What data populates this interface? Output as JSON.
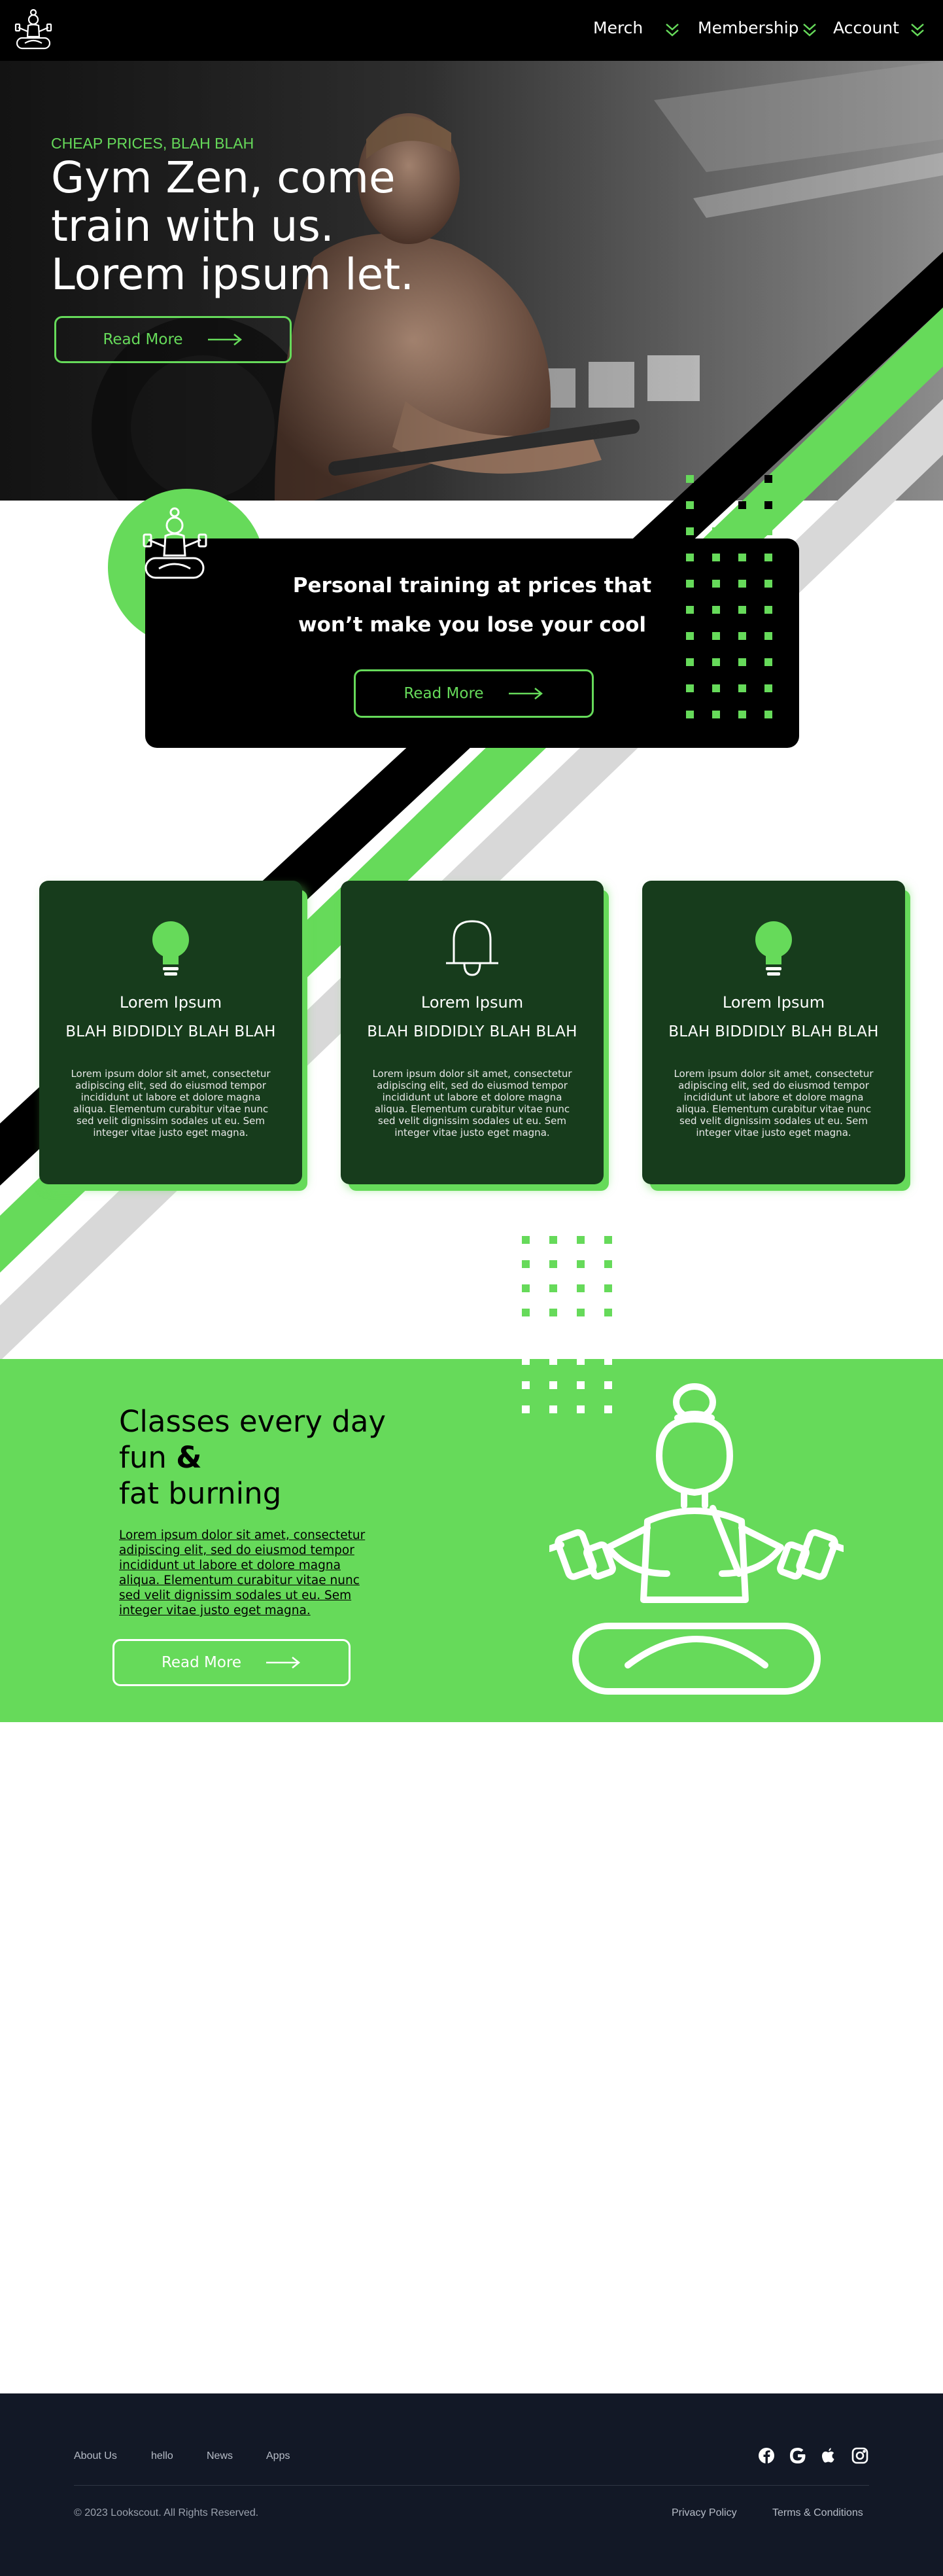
{
  "nav": {
    "logo_icon": "meditating-dumbbell-logo-icon",
    "items": [
      {
        "label": "Merch",
        "icon": "double-chevron-down-icon"
      },
      {
        "label": "Membership",
        "icon": "double-chevron-down-icon"
      },
      {
        "label": "Account",
        "icon": "double-chevron-down-icon"
      }
    ]
  },
  "hero": {
    "eyebrow": "CHEAP PRICES, BLAH BLAH",
    "title": "Gym Zen, come train with us. Lorem ipsum let.",
    "button_label": "Read More",
    "button_icon": "arrow-right-icon"
  },
  "cta": {
    "title": "Personal training at prices that won’t make you lose your cool",
    "button_label": "Read More",
    "button_icon": "arrow-right-icon"
  },
  "features": [
    {
      "icon": "lightbulb-icon",
      "title": "Lorem Ipsum",
      "subtitle": "BLAH BIDDIDLY BLAH BLAH",
      "body": "Lorem ipsum dolor sit amet, consectetur adipiscing elit, sed do eiusmod tempor incididunt ut labore et dolore magna aliqua. Elementum curabitur vitae nunc sed velit dignissim sodales ut eu. Sem integer vitae justo eget magna."
    },
    {
      "icon": "bell-icon",
      "title": "Lorem Ipsum",
      "subtitle": "BLAH BIDDIDLY BLAH BLAH",
      "body": "Lorem ipsum dolor sit amet, consectetur adipiscing elit, sed do eiusmod tempor incididunt ut labore et dolore magna aliqua. Elementum curabitur vitae nunc sed velit dignissim sodales ut eu. Sem integer vitae justo eget magna."
    },
    {
      "icon": "lightbulb-icon",
      "title": "Lorem Ipsum",
      "subtitle": "BLAH BIDDIDLY BLAH BLAH",
      "body": "Lorem ipsum dolor sit amet, consectetur adipiscing elit, sed do eiusmod tempor incididunt ut labore et dolore magna aliqua. Elementum curabitur vitae nunc sed velit dignissim sodales ut eu. Sem integer vitae justo eget magna."
    }
  ],
  "classes": {
    "title_line1": "Classes every day",
    "title_line2_a": "fun ",
    "title_line2_b": "&",
    "title_line3": "fat burning",
    "body": "Lorem ipsum dolor sit amet, consectetur adipiscing elit, sed do eiusmod tempor incididunt ut labore et dolore magna aliqua. Elementum curabitur vitae nunc sed velit dignissim sodales ut eu. Sem integer vitae justo eget magna.",
    "button_label": "Read More",
    "figure_icon": "meditating-dumbbell-figure-icon"
  },
  "footer": {
    "links": [
      "About Us",
      "hello",
      "News",
      "Apps"
    ],
    "social": [
      "facebook-icon",
      "google-icon",
      "apple-icon",
      "instagram-icon"
    ],
    "copyright": "© 2023 Lookscout. All Rights Reserved.",
    "legal": [
      "Privacy Policy",
      "Terms & Conditions"
    ]
  },
  "colors": {
    "accent_green": "#66da5a",
    "dark_green": "#173c1c",
    "nav_black": "#000000",
    "footer_navy": "#121826",
    "stripe_gray": "#d8d8d8"
  }
}
